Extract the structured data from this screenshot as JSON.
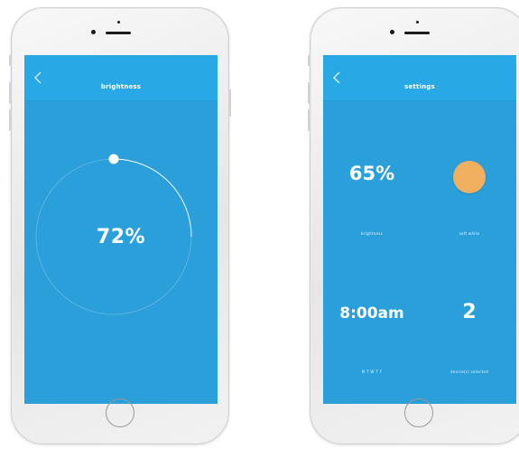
{
  "brightness_screen": {
    "title": "brightness",
    "value_label": "72%",
    "level": 0.72
  },
  "settings_screen": {
    "title": "settings",
    "brightness_value": "65%",
    "brightness_label": "brightness",
    "color_label": "soft white",
    "color_swatch": "#f0b060",
    "time_value": "8:00am",
    "days_label": "M T W T F",
    "devices_value": "2",
    "devices_label": "device(s) selected"
  },
  "colors": {
    "screen_bg": "#2a9fda",
    "nav_bg": "#28a8e4",
    "text": "#ffffff"
  }
}
